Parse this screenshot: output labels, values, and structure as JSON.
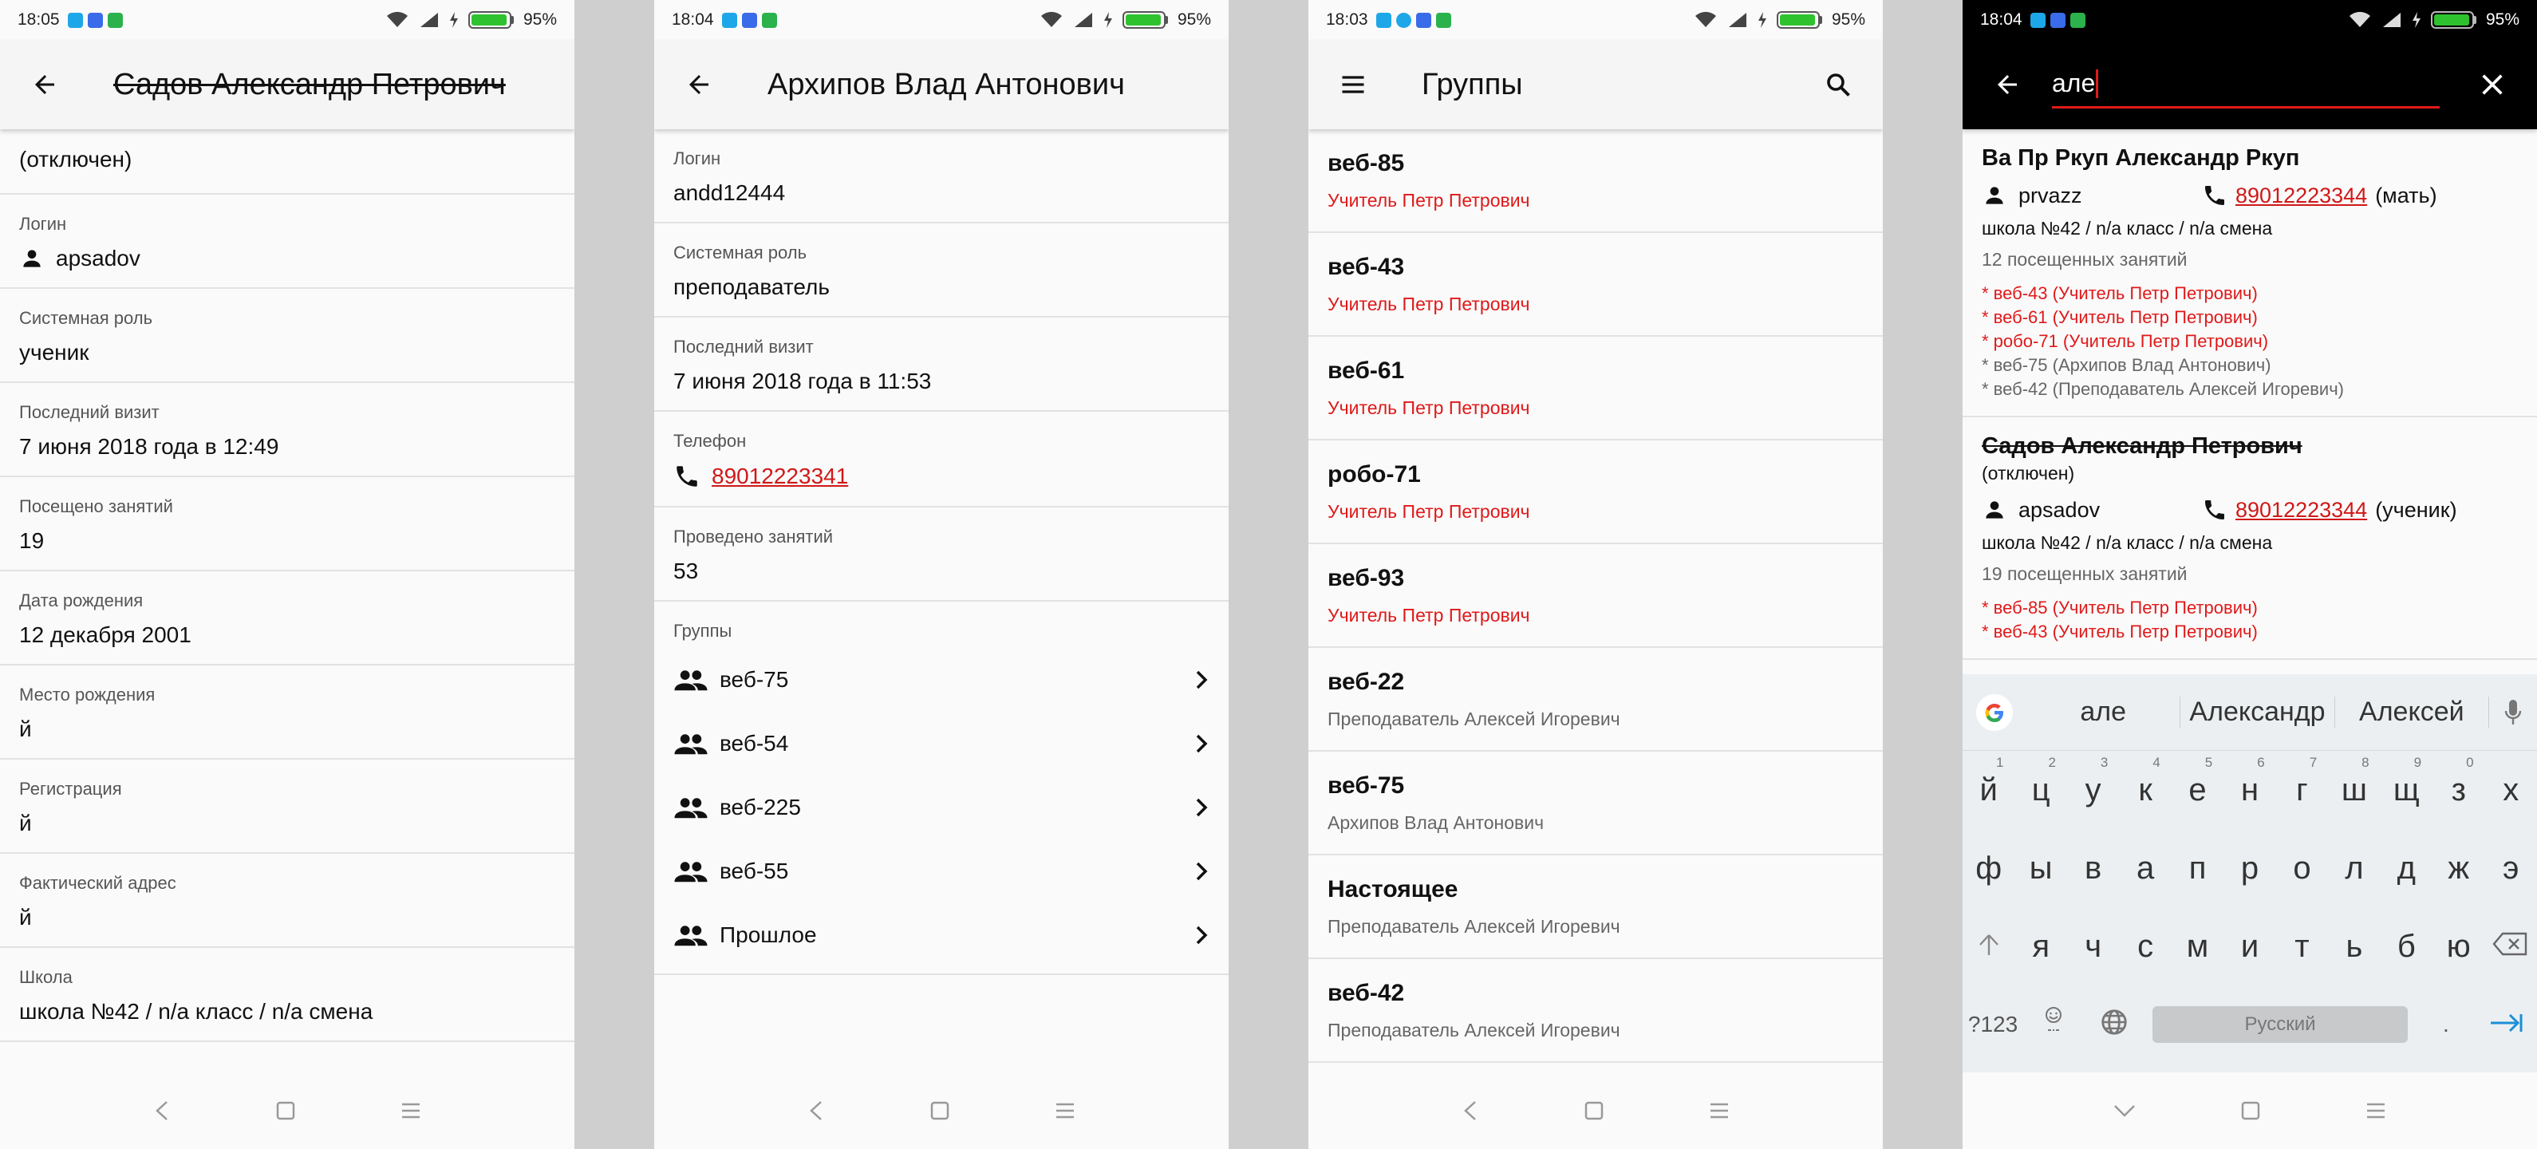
{
  "status_bars": [
    {
      "time": "18:05",
      "battery": "95%",
      "battery_level": 0.95,
      "notif_colors": [
        "#1ea7e8",
        "#3a6be8",
        "#2bb24c"
      ]
    },
    {
      "time": "18:04",
      "battery": "95%",
      "battery_level": 0.95,
      "notif_colors": [
        "#1ea7e8",
        "#3a6be8",
        "#2bb24c"
      ]
    },
    {
      "time": "18:03",
      "battery": "95%",
      "battery_level": 0.95,
      "notif_colors": [
        "#1ea7e8",
        "#1ea7e8",
        "#3a6be8",
        "#2bb24c"
      ]
    },
    {
      "time": "18:04",
      "battery": "95%",
      "battery_level": 0.95,
      "notif_colors": [
        "#1ea7e8",
        "#3a6be8",
        "#2bb24c"
      ]
    }
  ],
  "screen1": {
    "title": "Садов Александр Петрович",
    "status": "(отключен)",
    "login_label": "Логин",
    "login_value": "apsadov",
    "fields": [
      {
        "label": "Системная роль",
        "value": "ученик"
      },
      {
        "label": "Последний визит",
        "value": "7 июня 2018 года в 12:49"
      },
      {
        "label": "Посещено занятий",
        "value": "19"
      },
      {
        "label": "Дата рождения",
        "value": "12 декабря 2001"
      },
      {
        "label": "Место рождения",
        "value": "й"
      },
      {
        "label": "Регистрация",
        "value": "й"
      },
      {
        "label": "Фактический адрес",
        "value": "й"
      },
      {
        "label": "Школа",
        "value": "школа №42 / n/a класс / n/a смена"
      }
    ]
  },
  "screen2": {
    "title": "Архипов Влад Антонович",
    "fields": [
      {
        "label": "Логин",
        "value": "andd12444"
      },
      {
        "label": "Системная роль",
        "value": "преподаватель"
      },
      {
        "label": "Последний визит",
        "value": "7 июня 2018 года в 11:53"
      }
    ],
    "phone_label": "Телефон",
    "phone_value": "89012223341",
    "lessons_label": "Проведено занятий",
    "lessons_value": "53",
    "groups_label": "Группы",
    "groups": [
      "веб-75",
      "веб-54",
      "веб-225",
      "веб-55",
      "Прошлое"
    ]
  },
  "screen3": {
    "title": "Группы",
    "items": [
      {
        "name": "веб-85",
        "teacher": "Учитель Петр Петрович",
        "highlight": true
      },
      {
        "name": "веб-43",
        "teacher": "Учитель Петр Петрович",
        "highlight": true
      },
      {
        "name": "веб-61",
        "teacher": "Учитель Петр Петрович",
        "highlight": true
      },
      {
        "name": "робо-71",
        "teacher": "Учитель Петр Петрович",
        "highlight": true
      },
      {
        "name": "веб-93",
        "teacher": "Учитель Петр Петрович",
        "highlight": true
      },
      {
        "name": "веб-22",
        "teacher": "Преподаватель Алексей Игоревич",
        "highlight": false
      },
      {
        "name": "веб-75",
        "teacher": "Архипов Влад Антонович",
        "highlight": false
      },
      {
        "name": "Настоящее",
        "teacher": "Преподаватель Алексей Игоревич",
        "highlight": false
      },
      {
        "name": "веб-42",
        "teacher": "Преподаватель Алексей Игоревич",
        "highlight": false
      }
    ]
  },
  "screen4": {
    "search_query": "але",
    "results": [
      {
        "name": "Ва Пр Ркуп Александр Ркуп",
        "disabled": false,
        "login": "prvazz",
        "phone": "89012223344",
        "phone_note": "(мать)",
        "school": "школа №42 / n/a класс / n/a смена",
        "visits": "12 посещенных занятий",
        "groups": [
          {
            "text": "* веб-43 (Учитель Петр Петрович)",
            "red": true
          },
          {
            "text": "* веб-61 (Учитель Петр Петрович)",
            "red": true
          },
          {
            "text": "* робо-71 (Учитель Петр Петрович)",
            "red": true
          },
          {
            "text": "* веб-75 (Архипов Влад Антонович)",
            "red": false
          },
          {
            "text": "* веб-42 (Преподаватель Алексей Игоревич)",
            "red": false
          }
        ]
      },
      {
        "name": "Садов Александр Петрович",
        "disabled": true,
        "status": "(отключен)",
        "login": "apsadov",
        "phone": "89012223344",
        "phone_note": "(ученик)",
        "school": "школа №42 / n/a класс / n/a смена",
        "visits": "19 посещенных занятий",
        "groups": [
          {
            "text": "* веб-85 (Учитель Петр Петрович)",
            "red": true
          },
          {
            "text": "* веб-43 (Учитель Петр Петрович)",
            "red": true
          }
        ]
      }
    ],
    "keyboard": {
      "suggestions": [
        "але",
        "Александр",
        "Алексей"
      ],
      "row1": [
        [
          "й",
          "1"
        ],
        [
          "ц",
          "2"
        ],
        [
          "у",
          "3"
        ],
        [
          "к",
          "4"
        ],
        [
          "е",
          "5"
        ],
        [
          "н",
          "6"
        ],
        [
          "г",
          "7"
        ],
        [
          "ш",
          "8"
        ],
        [
          "щ",
          "9"
        ],
        [
          "з",
          "0"
        ],
        [
          "х",
          ""
        ]
      ],
      "row2": [
        "ф",
        "ы",
        "в",
        "а",
        "п",
        "р",
        "о",
        "л",
        "д",
        "ж",
        "э"
      ],
      "row3": [
        "я",
        "ч",
        "с",
        "м",
        "и",
        "т",
        "ь",
        "б",
        "ю"
      ],
      "numbers_key": "?123",
      "space_label": "Русский",
      "period_key": "."
    }
  },
  "colors": {
    "accent_red": "#e01919",
    "battery_green": "#2fc22f"
  }
}
